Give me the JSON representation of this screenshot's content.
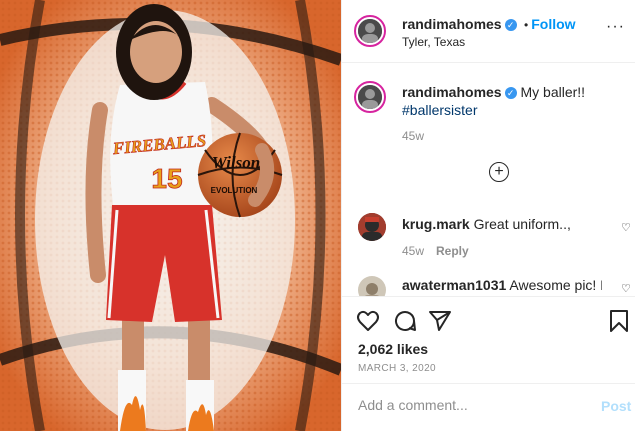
{
  "post": {
    "author": "randimahomes",
    "verified_icon": "verified-badge-icon",
    "follow_separator": "•",
    "follow_label": "Follow",
    "location": "Tyler, Texas",
    "more_icon": "ellipsis-icon",
    "more_glyph": "···"
  },
  "image": {
    "jersey_team": "FIREBALLS",
    "jersey_number": "15",
    "ball_brand": "Wilson",
    "ball_model": "EVOLUTION"
  },
  "caption": {
    "author": "randimahomes",
    "text": "My baller!!",
    "hashtag": "#ballersister",
    "time": "45w"
  },
  "load_more_glyph": "+",
  "comments": [
    {
      "author": "krug.mark",
      "text": "Great uniform..,",
      "time": "45w",
      "reply_label": "Reply"
    },
    {
      "author": "awaterman1031",
      "text": "Awesome pic! L",
      "emoji": "❤"
    }
  ],
  "likes": "2,062 likes",
  "date": "MARCH 3, 2020",
  "add_comment": {
    "placeholder": "Add a comment...",
    "post_label": "Post"
  },
  "colors": {
    "accent": "#0095f6",
    "hashtag": "#00376b",
    "muted": "#8e8e8e",
    "post_disabled": "#b2dffc",
    "jersey_red": "#d7322b"
  }
}
